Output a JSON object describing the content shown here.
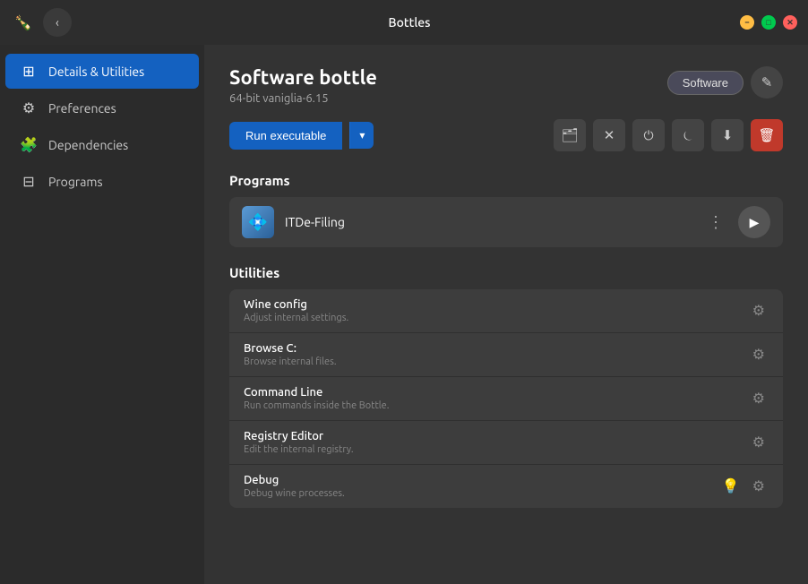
{
  "titlebar": {
    "title": "Bottles",
    "back_icon": "‹",
    "app_icon": "🍾"
  },
  "sidebar": {
    "items": [
      {
        "id": "details",
        "label": "Details & Utilities",
        "icon": "⊞",
        "active": true
      },
      {
        "id": "preferences",
        "label": "Preferences",
        "icon": "⚙",
        "active": false
      },
      {
        "id": "dependencies",
        "label": "Dependencies",
        "icon": "🧩",
        "active": false
      },
      {
        "id": "programs",
        "label": "Programs",
        "icon": "⊟",
        "active": false
      }
    ]
  },
  "bottle": {
    "name": "Software bottle",
    "subtitle": "64-bit vaniglia-6.15",
    "tag": "Software"
  },
  "actions": {
    "run_executable": "Run executable",
    "dropdown_icon": "▾"
  },
  "programs_section": {
    "title": "Programs",
    "items": [
      {
        "name": "ITDe-Filing",
        "icon": "💠"
      }
    ]
  },
  "utilities_section": {
    "title": "Utilities",
    "items": [
      {
        "name": "Wine config",
        "desc": "Adjust internal settings."
      },
      {
        "name": "Browse C:",
        "desc": "Browse internal files."
      },
      {
        "name": "Command Line",
        "desc": "Run commands inside the Bottle."
      },
      {
        "name": "Registry Editor",
        "desc": "Edit the internal registry."
      },
      {
        "name": "Debug",
        "desc": "Debug wine processes."
      }
    ]
  },
  "icons": {
    "back": "‹",
    "edit": "✎",
    "folder": "📁",
    "close_x": "✕",
    "power_off": "⏻",
    "power_on": "⏻",
    "download": "⬇",
    "trash": "🗑",
    "gear": "⚙",
    "bulb": "💡",
    "play": "▶",
    "menu_dots": "⋮",
    "chevron": "▾"
  },
  "colors": {
    "accent": "#1461c0",
    "sidebar_bg": "#2b2b2b",
    "content_bg": "#333333",
    "row_bg": "#3d3d3d",
    "red": "#c0392b"
  }
}
